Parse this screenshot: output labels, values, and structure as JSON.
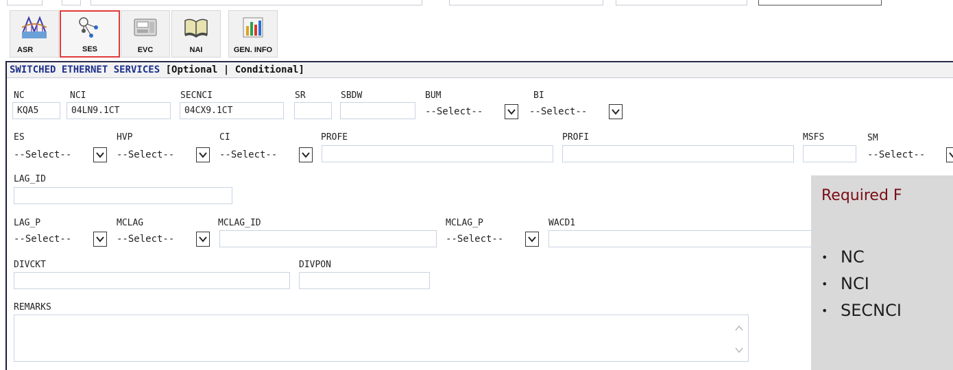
{
  "toolbar": {
    "buttons": [
      {
        "label": "ASR",
        "icon": "bridge-icon"
      },
      {
        "label": "SES",
        "icon": "network-icon",
        "active": true
      },
      {
        "label": "EVC",
        "icon": "phone-icon"
      },
      {
        "label": "NAI",
        "icon": "book-icon"
      },
      {
        "label": "GEN. INFO",
        "icon": "chart-icon"
      }
    ]
  },
  "panel": {
    "title": "SWITCHED ETHERNET SERVICES",
    "subtitle": " [Optional | Conditional]"
  },
  "fields": {
    "nc": {
      "label": "NC",
      "value": "KQA5"
    },
    "nci": {
      "label": "NCI",
      "value": "04LN9.1CT"
    },
    "secnci": {
      "label": "SECNCI",
      "value": "04CX9.1CT"
    },
    "sr": {
      "label": "SR",
      "value": ""
    },
    "sbdw": {
      "label": "SBDW",
      "value": ""
    },
    "bum": {
      "label": "BUM",
      "value": "--Select--"
    },
    "bi": {
      "label": "BI",
      "value": "--Select--"
    },
    "es": {
      "label": "ES",
      "value": "--Select--"
    },
    "hvp": {
      "label": "HVP",
      "value": "--Select--"
    },
    "ci": {
      "label": "CI",
      "value": "--Select--"
    },
    "profe": {
      "label": "PROFE",
      "value": ""
    },
    "profi": {
      "label": "PROFI",
      "value": ""
    },
    "msfs": {
      "label": "MSFS",
      "value": ""
    },
    "sm": {
      "label": "SM",
      "value": "--Select--"
    },
    "lag_id": {
      "label": "LAG_ID",
      "value": ""
    },
    "lag_p": {
      "label": "LAG_P",
      "value": "--Select--"
    },
    "mclag": {
      "label": "MCLAG",
      "value": "--Select--"
    },
    "mclag_id": {
      "label": "MCLAG_ID",
      "value": ""
    },
    "mclag_p": {
      "label": "MCLAG_P",
      "value": "--Select--"
    },
    "wacd1": {
      "label": "WACD1",
      "value": ""
    },
    "divckt": {
      "label": "DIVCKT",
      "value": ""
    },
    "divpon": {
      "label": "DIVPON",
      "value": ""
    },
    "remarks": {
      "label": "REMARKS",
      "value": ""
    }
  },
  "required_panel": {
    "title": "Required F",
    "items": [
      "NC",
      "NCI",
      "SECNCI"
    ]
  },
  "colors": {
    "active_border": "#e03a3a",
    "panel_title": "#1c2f8a",
    "required_title": "#7a0c14",
    "required_bg": "#d9d9d9"
  }
}
